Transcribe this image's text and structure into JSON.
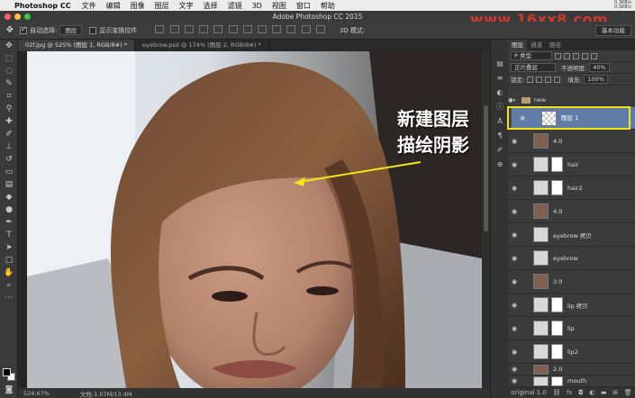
{
  "menubar": {
    "app_name": "Photoshop CC",
    "items": [
      "文件",
      "编辑",
      "图像",
      "图层",
      "文字",
      "选择",
      "滤镜",
      "3D",
      "视图",
      "窗口",
      "帮助"
    ],
    "net_up": "0.3KB/s",
    "net_down": "0.5KB/s"
  },
  "window": {
    "title": "Adobe Photoshop CC 2015"
  },
  "watermark": "www.16xx8.com",
  "options": {
    "auto_select_label": "自动选择:",
    "auto_select_value": "图层",
    "show_transform_label": "显示变换控件",
    "mode_3d": "3D 模式:",
    "workspace": "基本功能"
  },
  "tabs": [
    {
      "label": "02f.jpg @ 525% (图层 1, RGB/8#) *"
    },
    {
      "label": "eyebrow.psd @ 174% (图层 2, RGB/8#) *"
    }
  ],
  "annotation": {
    "line1": "新建图层",
    "line2": "描绘阴影"
  },
  "status": {
    "zoom": "524.67%",
    "doc": "文档:1.07M/13.4M"
  },
  "layers_panel": {
    "tabs": [
      "图层",
      "通道",
      "路径"
    ],
    "kind_filter": "P 类型",
    "blend_mode": "正片叠底",
    "opacity_label": "不透明度:",
    "opacity_value": "40%",
    "lock_label": "锁定:",
    "fill_label": "填充:",
    "fill_value": "100%",
    "group_name": "new",
    "layers": [
      {
        "name": "图层 1",
        "selected": true,
        "mask": false
      },
      {
        "name": "4.0",
        "selected": false,
        "mask": false
      },
      {
        "name": "hair",
        "selected": false,
        "mask": true
      },
      {
        "name": "hair2",
        "selected": false,
        "mask": true
      },
      {
        "name": "4.0",
        "selected": false,
        "mask": false
      },
      {
        "name": "eyebrow 拷贝",
        "selected": false,
        "mask": false
      },
      {
        "name": "eyebrow",
        "selected": false,
        "mask": false
      },
      {
        "name": "3.0",
        "selected": false,
        "mask": false
      },
      {
        "name": "lip 拷贝",
        "selected": false,
        "mask": true
      },
      {
        "name": "lip",
        "selected": false,
        "mask": true
      },
      {
        "name": "lip2",
        "selected": false,
        "mask": true
      },
      {
        "name": "2.0",
        "selected": false,
        "mask": false
      },
      {
        "name": "mouth",
        "selected": false,
        "mask": true
      },
      {
        "name": "original 1.0",
        "selected": false,
        "mask": false
      }
    ]
  },
  "colors": {
    "accent_select": "#5f7ca6",
    "highlight": "#f3e617",
    "annotation_arrow": "#f3e617"
  }
}
